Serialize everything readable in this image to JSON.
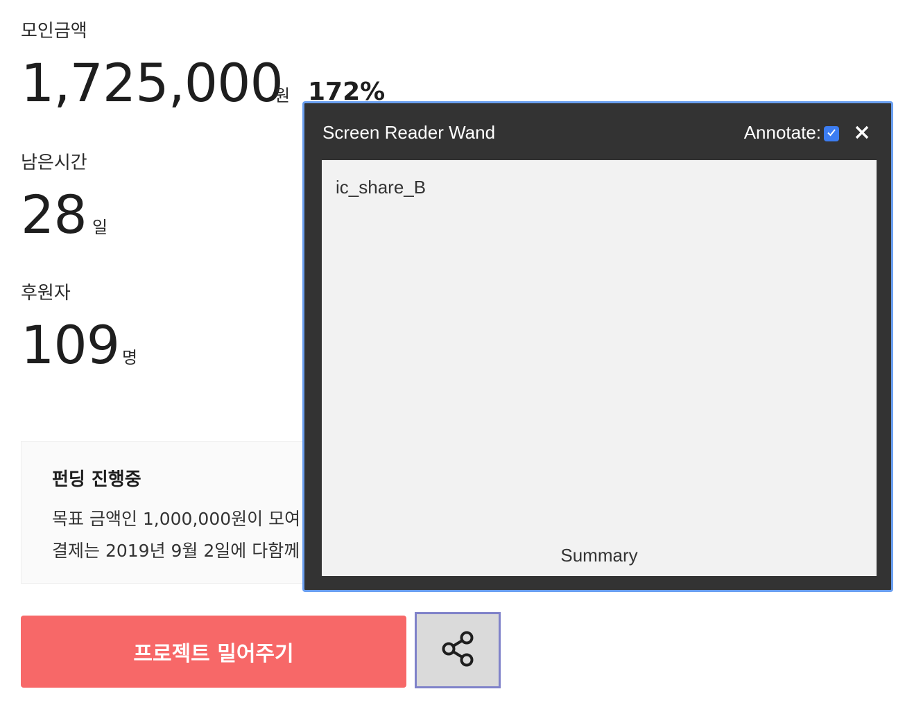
{
  "stats": {
    "amount": {
      "label": "모인금액",
      "value": "1,725,000",
      "unit": "원",
      "percent": "172%"
    },
    "time": {
      "label": "남은시간",
      "value": "28",
      "unit": "일"
    },
    "backers": {
      "label": "후원자",
      "value": "109",
      "unit": "명"
    }
  },
  "status": {
    "title": "펀딩 진행중",
    "line1": "목표 금액인 1,000,000원이 모여",
    "line2": "결제는 2019년 9월 2일에 다함께"
  },
  "actions": {
    "cta_label": "프로젝트 밀어주기",
    "share_icon": "share-icon"
  },
  "wand": {
    "title": "Screen Reader Wand",
    "annotate_label": "Annotate:",
    "annotate_checked": true,
    "content": "ic_share_B",
    "summary": "Summary",
    "border_color": "#6a9ff0"
  },
  "colors": {
    "cta": "#f76868",
    "share_border": "#7f82c9",
    "checkbox": "#3c7df2"
  }
}
